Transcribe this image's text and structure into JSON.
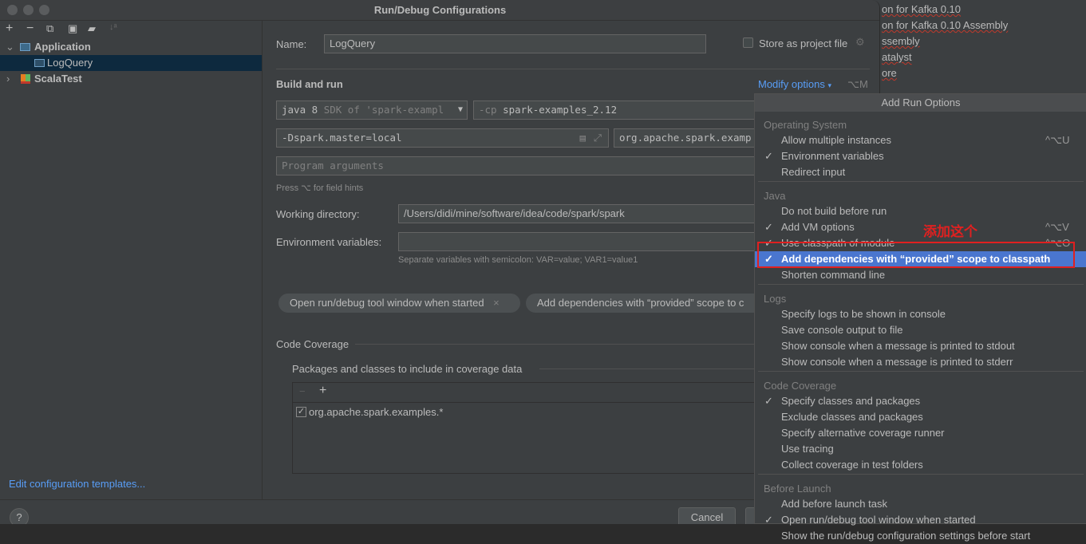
{
  "window": {
    "title": "Run/Debug Configurations"
  },
  "background_lines": [
    "on for Kafka 0.10",
    "on for Kafka 0.10 Assembly",
    "ssembly",
    "atalyst",
    "ore"
  ],
  "toolbar": {
    "icons": [
      "plus-icon",
      "minus-icon",
      "copy-icon",
      "save-icon",
      "new-folder-icon",
      "sort-icon"
    ]
  },
  "tree": {
    "items": [
      {
        "label": "Application",
        "expanded": true
      },
      {
        "label": "LogQuery",
        "selected": true
      },
      {
        "label": "ScalaTest",
        "expanded": false
      }
    ]
  },
  "sidebar": {
    "edit_templates": "Edit configuration templates...",
    "help": "?"
  },
  "form": {
    "name_label": "Name:",
    "name_value": "LogQuery",
    "store_label": "Store as project file",
    "build_run": "Build and run",
    "modify_options": "Modify options",
    "modify_shortcut": "⌥M",
    "jdk_main": "java 8",
    "jdk_sub": "SDK of 'spark-exampl",
    "cp_prefix": "-cp",
    "cp_value": "spark-examples_2.12",
    "vm_options": "-Dspark.master=local",
    "main_class": "org.apache.spark.examp",
    "program_args_placeholder": "Program arguments",
    "field_hint": "Press ⌥ for field hints",
    "workdir_label": "Working directory:",
    "workdir_value": "/Users/didi/mine/software/idea/code/spark/spark",
    "env_label": "Environment variables:",
    "env_value": "",
    "env_hint": "Separate variables with semicolon: VAR=value; VAR1=value1",
    "chips": [
      "Open run/debug tool window when started",
      "Add dependencies with “provided” scope to c"
    ],
    "coverage_title": "Code Coverage",
    "coverage_sub": "Packages and classes to include in coverage data",
    "coverage_items": [
      {
        "label": "org.apache.spark.examples.*",
        "checked": true
      }
    ],
    "cancel": "Cancel"
  },
  "popup": {
    "title": "Add Run Options",
    "groups": [
      {
        "label": "Operating System",
        "items": [
          {
            "label": "Allow multiple instances",
            "shortcut": "^⌥U"
          },
          {
            "label": "Environment variables",
            "checked": true
          },
          {
            "label": "Redirect input"
          }
        ]
      },
      {
        "label": "Java",
        "items": [
          {
            "label": "Do not build before run"
          },
          {
            "label": "Add VM options",
            "checked": true,
            "shortcut": "^⌥V"
          },
          {
            "label": "Use classpath of module",
            "checked": true,
            "shortcut": "^⌥O"
          },
          {
            "label": "Add dependencies with “provided” scope to classpath",
            "checked": true,
            "highlighted": true
          },
          {
            "label": "Shorten command line"
          }
        ]
      },
      {
        "label": "Logs",
        "items": [
          {
            "label": "Specify logs to be shown in console"
          },
          {
            "label": "Save console output to file"
          },
          {
            "label": "Show console when a message is printed to stdout"
          },
          {
            "label": "Show console when a message is printed to stderr"
          }
        ]
      },
      {
        "label": "Code Coverage",
        "items": [
          {
            "label": "Specify classes and packages",
            "checked": true
          },
          {
            "label": "Exclude classes and packages"
          },
          {
            "label": "Specify alternative coverage runner"
          },
          {
            "label": "Use tracing"
          },
          {
            "label": "Collect coverage in test folders"
          }
        ]
      },
      {
        "label": "Before Launch",
        "items": [
          {
            "label": "Add before launch task"
          },
          {
            "label": "Open run/debug tool window when started",
            "checked": true
          },
          {
            "label": "Show the run/debug configuration settings before start"
          }
        ]
      }
    ]
  },
  "annotation": {
    "text": "添加这个",
    "color": "#e02020"
  },
  "colors": {
    "highlight": "#4a76cf",
    "link": "#589df6",
    "selection": "#0d293e"
  }
}
